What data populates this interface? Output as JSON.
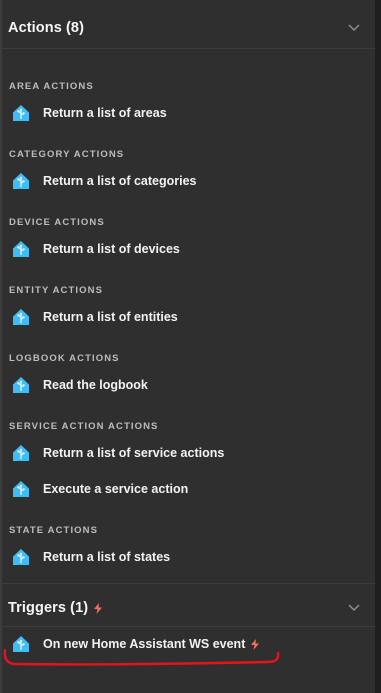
{
  "actions_section": {
    "title": "Actions (8)"
  },
  "groups": [
    {
      "label": "AREA ACTIONS",
      "items": [
        "Return a list of areas"
      ]
    },
    {
      "label": "CATEGORY ACTIONS",
      "items": [
        "Return a list of categories"
      ]
    },
    {
      "label": "DEVICE ACTIONS",
      "items": [
        "Return a list of devices"
      ]
    },
    {
      "label": "ENTITY ACTIONS",
      "items": [
        "Return a list of entities"
      ]
    },
    {
      "label": "LOGBOOK ACTIONS",
      "items": [
        "Read the logbook"
      ]
    },
    {
      "label": "SERVICE ACTION ACTIONS",
      "items": [
        "Return a list of service actions",
        "Execute a service action"
      ]
    },
    {
      "label": "STATE ACTIONS",
      "items": [
        "Return a list of states"
      ]
    }
  ],
  "triggers_section": {
    "title": "Triggers (1)",
    "items": [
      "On new Home Assistant WS event"
    ]
  },
  "icons": {
    "item_icon": "home-assistant-icon",
    "trigger_marker": "bolt-icon",
    "expand": "chevron-down-icon"
  },
  "colors": {
    "background": "#2f2f30",
    "brand_blue": "#41bdf5",
    "trigger_accent": "#ff6d5a",
    "annotation_red": "#e5141b"
  }
}
